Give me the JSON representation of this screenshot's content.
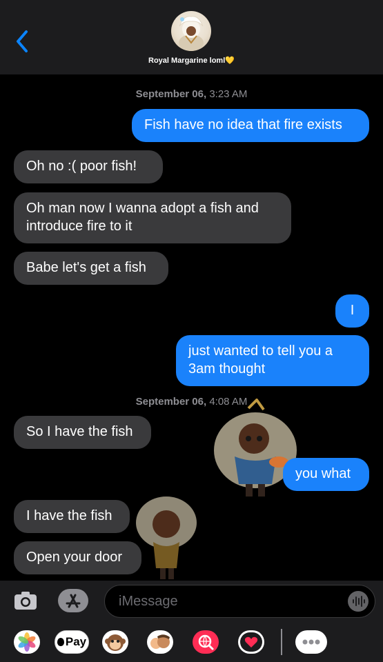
{
  "header": {
    "contact_name": "Royal Margarine loml💛"
  },
  "messages": [
    {
      "type": "timestamp",
      "date": "September 06,",
      "time": "3:23 AM"
    },
    {
      "type": "out",
      "text": "Fish have no idea that fire exists"
    },
    {
      "type": "in",
      "text": "Oh no :(  poor fish!"
    },
    {
      "type": "in",
      "text": "Oh man now I wanna adopt a fish and introduce fire to it"
    },
    {
      "type": "in",
      "text": "Babe let's get a fish"
    },
    {
      "type": "out",
      "text": "I"
    },
    {
      "type": "out",
      "text": "just wanted to tell you a 3am thought"
    },
    {
      "type": "timestamp",
      "date": "September 06,",
      "time": "4:08 AM"
    },
    {
      "type": "in",
      "text": "So I have the fish"
    },
    {
      "type": "out",
      "text": "you what"
    },
    {
      "type": "in",
      "text": "I have the fish"
    },
    {
      "type": "in",
      "text": "Open your door"
    }
  ],
  "composer": {
    "placeholder": "iMessage"
  },
  "app_bar": {
    "apple_pay_label": "Pay"
  },
  "colors": {
    "incoming_bubble": "#3a3a3c",
    "outgoing_bubble": "#1a82fb",
    "accent": "#0a84ff"
  }
}
